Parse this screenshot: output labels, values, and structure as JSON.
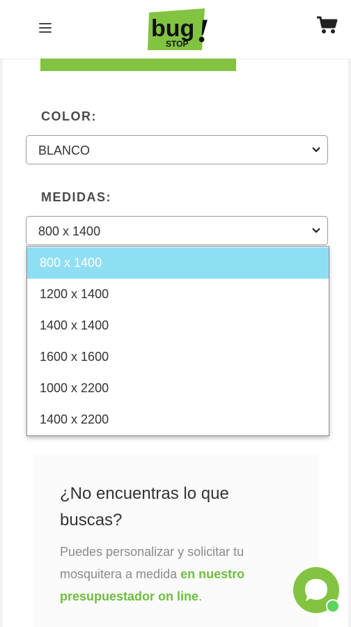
{
  "header": {
    "logo_main": "bug",
    "logo_sub": "STOP",
    "logo_mark": "!"
  },
  "color_section": {
    "label": "COLOR:",
    "selected": "BLANCO"
  },
  "medidas_section": {
    "label": "MEDIDAS:",
    "selected": "800 x 1400",
    "options": [
      "800 x 1400",
      "1200 x 1400",
      "1400 x 1400",
      "1600 x 1600",
      "1000 x 2200",
      "1400 x 2200"
    ]
  },
  "info": {
    "title": "¿No encuentras lo que buscas?",
    "text_plain": "Puedes personalizar y solicitar tu mosquitera a medida ",
    "text_link": "en nuestro presupuestador on line",
    "text_end": "."
  },
  "icons": {
    "menu": "hamburger-menu-icon",
    "cart": "shopping-cart-icon",
    "chevron": "chevron-down-icon",
    "chat": "chat-bubble-icon"
  },
  "colors": {
    "brand_green": "#82c341",
    "link_green": "#6dbf3d",
    "option_highlight": "#8fdff4"
  }
}
